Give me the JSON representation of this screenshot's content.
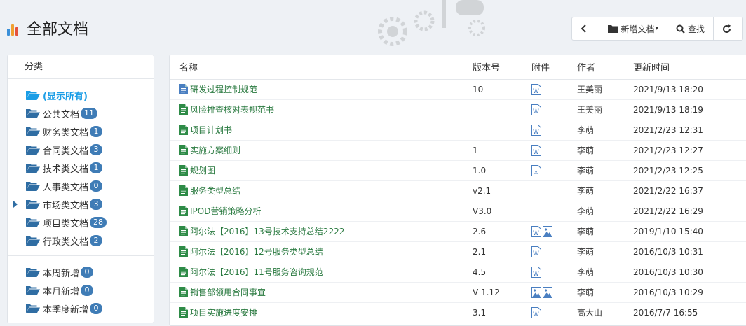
{
  "page": {
    "title": "全部文档"
  },
  "toolbar": {
    "new_label": "新增文档",
    "search_label": "查找"
  },
  "sidebar": {
    "header": "分类",
    "items": [
      {
        "label": "(显示所有)",
        "active": true
      },
      {
        "label": "公共文档",
        "count": "11"
      },
      {
        "label": "财务类文档",
        "count": "1"
      },
      {
        "label": "合同类文档",
        "count": "3"
      },
      {
        "label": "技术类文档",
        "count": "1"
      },
      {
        "label": "人事类文档",
        "count": "0"
      },
      {
        "label": "市场类文档",
        "count": "3",
        "expandable": true
      },
      {
        "label": "项目类文档",
        "count": "28"
      },
      {
        "label": "行政类文档",
        "count": "2"
      }
    ],
    "recent": [
      {
        "label": "本周新增",
        "count": "0"
      },
      {
        "label": "本月新增",
        "count": "0"
      },
      {
        "label": "本季度新增",
        "count": "0"
      }
    ]
  },
  "table": {
    "headers": {
      "name": "名称",
      "version": "版本号",
      "attach": "附件",
      "author": "作者",
      "updated": "更新时间"
    },
    "rows": [
      {
        "name": "研发过程控制规范",
        "version": "10",
        "author": "王美丽",
        "updated": "2021/9/13 18:20",
        "attachments": [
          "word-icon"
        ],
        "file_icon": "doc-blue-icon"
      },
      {
        "name": "风险排查核对表规范书",
        "version": "",
        "author": "王美丽",
        "updated": "2021/9/13 18:19",
        "attachments": [
          "word-icon"
        ],
        "file_icon": "doc-green-icon"
      },
      {
        "name": "项目计划书",
        "version": "",
        "author": "李萌",
        "updated": "2021/2/23 12:31",
        "attachments": [
          "word-icon"
        ],
        "file_icon": "doc-green-icon"
      },
      {
        "name": "实施方案细则",
        "version": "1",
        "author": "李萌",
        "updated": "2021/2/23 12:27",
        "attachments": [
          "word-icon"
        ],
        "file_icon": "doc-green-icon"
      },
      {
        "name": "规划图",
        "version": "1.0",
        "author": "李萌",
        "updated": "2021/2/23 12:25",
        "attachments": [
          "excel-icon"
        ],
        "file_icon": "doc-green-icon"
      },
      {
        "name": "服务类型总结",
        "version": "v2.1",
        "author": "李萌",
        "updated": "2021/2/22 16:37",
        "attachments": [],
        "file_icon": "doc-green-icon"
      },
      {
        "name": "IPOD营销策略分析",
        "version": "V3.0",
        "author": "李萌",
        "updated": "2021/2/22 16:29",
        "attachments": [],
        "file_icon": "doc-green-icon"
      },
      {
        "name": "阿尔法【2016】13号技术支持总结2222",
        "version": "2.6",
        "author": "李萌",
        "updated": "2019/1/10 15:40",
        "attachments": [
          "word-icon",
          "image-icon"
        ],
        "file_icon": "doc-green-icon"
      },
      {
        "name": "阿尔法【2016】12号服务类型总结",
        "version": "2.1",
        "author": "李萌",
        "updated": "2016/10/3 10:31",
        "attachments": [
          "word-icon"
        ],
        "file_icon": "doc-green-icon"
      },
      {
        "name": "阿尔法【2016】11号服务咨询规范",
        "version": "4.5",
        "author": "李萌",
        "updated": "2016/10/3 10:30",
        "attachments": [
          "word-icon"
        ],
        "file_icon": "doc-green-icon"
      },
      {
        "name": "销售部领用合同事宜",
        "version": "V 1.12",
        "author": "李萌",
        "updated": "2016/10/3 10:29",
        "attachments": [
          "image-icon",
          "image-icon"
        ],
        "file_icon": "doc-green-icon"
      },
      {
        "name": "项目实施进度安排",
        "version": "3.1",
        "author": "高大山",
        "updated": "2016/7/7 16:55",
        "attachments": [
          "word-icon"
        ],
        "file_icon": "doc-green-icon"
      }
    ]
  },
  "colors": {
    "accent": "#1a9de6",
    "badge": "#3f7cb6",
    "folder": "#2f6da3",
    "doc_green": "#2e8b47",
    "doc_blue": "#4a7fc1",
    "link": "#2a7a40"
  }
}
